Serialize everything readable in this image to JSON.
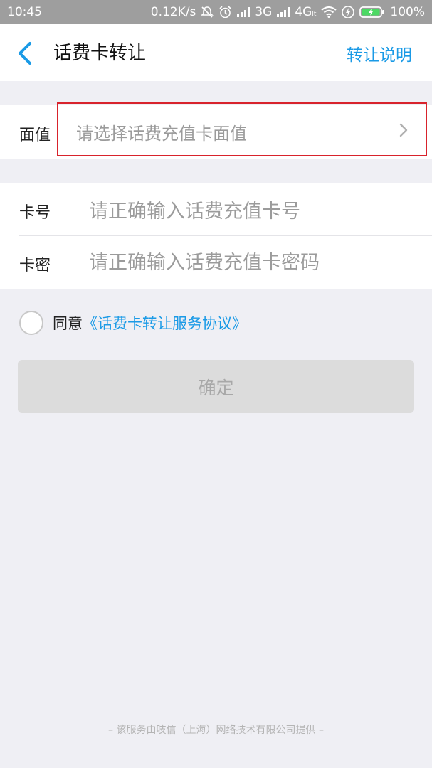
{
  "status_bar": {
    "time": "10:45",
    "speed": "0.12K/s",
    "net1": "3G",
    "net2": "4G",
    "net2_sub": "lt",
    "battery": "100%"
  },
  "nav": {
    "title": "话费卡转让",
    "action": "转让说明"
  },
  "form": {
    "face_value_label": "面值",
    "face_value_placeholder": "请选择话费充值卡面值",
    "card_number_label": "卡号",
    "card_number_placeholder": "请正确输入话费充值卡号",
    "card_password_label": "卡密",
    "card_password_placeholder": "请正确输入话费充值卡密码"
  },
  "agreement": {
    "prefix": "同意",
    "link": "《话费卡转让服务协议》"
  },
  "confirm_button": "确定",
  "footer": "– 该服务由吱信（上海）网络技术有限公司提供 –",
  "colors": {
    "accent": "#1a9ae6",
    "highlight": "#d8232c",
    "background": "#efeff4"
  }
}
